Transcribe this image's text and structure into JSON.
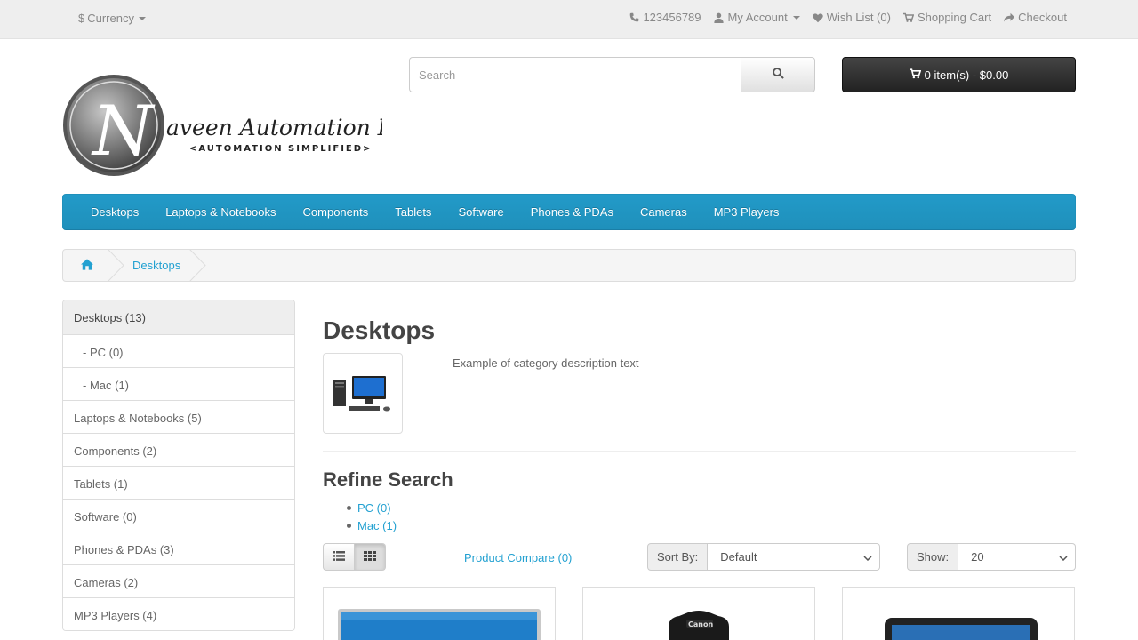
{
  "topbar": {
    "currency_label": "Currency",
    "currency_symbol": "$",
    "phone": "123456789",
    "my_account": "My Account",
    "wish_list": "Wish List (0)",
    "shopping_cart": "Shopping Cart",
    "checkout": "Checkout"
  },
  "logo": {
    "brand_initial": "N",
    "brand_text": "aveen Automation Labs",
    "tagline": "<AUTOMATION SIMPLIFIED>"
  },
  "search": {
    "placeholder": "Search"
  },
  "cart": {
    "label": "0 item(s) - $0.00"
  },
  "menu": {
    "items": [
      "Desktops",
      "Laptops & Notebooks",
      "Components",
      "Tablets",
      "Software",
      "Phones & PDAs",
      "Cameras",
      "MP3 Players"
    ]
  },
  "breadcrumb": {
    "current": "Desktops"
  },
  "sidebar": {
    "items": [
      {
        "label": "Desktops (13)"
      },
      {
        "label": "- PC (0)"
      },
      {
        "label": "- Mac (1)"
      },
      {
        "label": "Laptops & Notebooks (5)"
      },
      {
        "label": "Components (2)"
      },
      {
        "label": "Tablets (1)"
      },
      {
        "label": "Software (0)"
      },
      {
        "label": "Phones & PDAs (3)"
      },
      {
        "label": "Cameras (2)"
      },
      {
        "label": "MP3 Players (4)"
      }
    ]
  },
  "main": {
    "title": "Desktops",
    "description": "Example of category description text",
    "refine_title": "Refine Search",
    "refine_links": [
      "PC (0)",
      "Mac (1)"
    ],
    "product_compare": "Product Compare (0)",
    "sort_label": "Sort By:",
    "sort_value": "Default",
    "show_label": "Show:",
    "show_value": "20",
    "product_count_visible": 3
  },
  "colors": {
    "menu_blue": "#229ac8",
    "link_blue": "#23a1d1",
    "cart_dark": "#303030"
  }
}
